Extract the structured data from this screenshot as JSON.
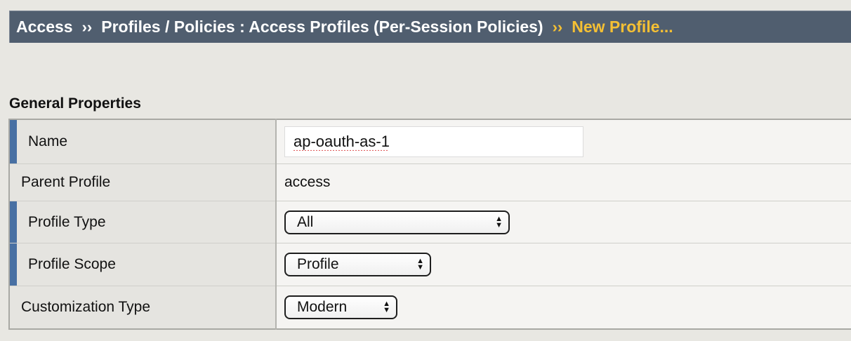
{
  "breadcrumb": {
    "root": "Access",
    "separator": "››",
    "section": "Profiles / Policies : Access Profiles (Per-Session Policies)",
    "current": "New Profile..."
  },
  "section_title": "General Properties",
  "rows": {
    "name": {
      "label": "Name",
      "value": "ap-oauth-as-1",
      "required": true
    },
    "parent_profile": {
      "label": "Parent Profile",
      "value": "access",
      "required": false
    },
    "profile_type": {
      "label": "Profile Type",
      "selected": "All",
      "required": true
    },
    "profile_scope": {
      "label": "Profile Scope",
      "selected": "Profile",
      "required": true
    },
    "customization_type": {
      "label": "Customization Type",
      "selected": "Modern",
      "required": false
    }
  },
  "icons": {
    "select_arrows": "up-down-chevron-icon"
  },
  "colors": {
    "breadcrumb_bg": "#505e6f",
    "breadcrumb_current": "#f5c034",
    "required_marker": "#4870a3"
  }
}
